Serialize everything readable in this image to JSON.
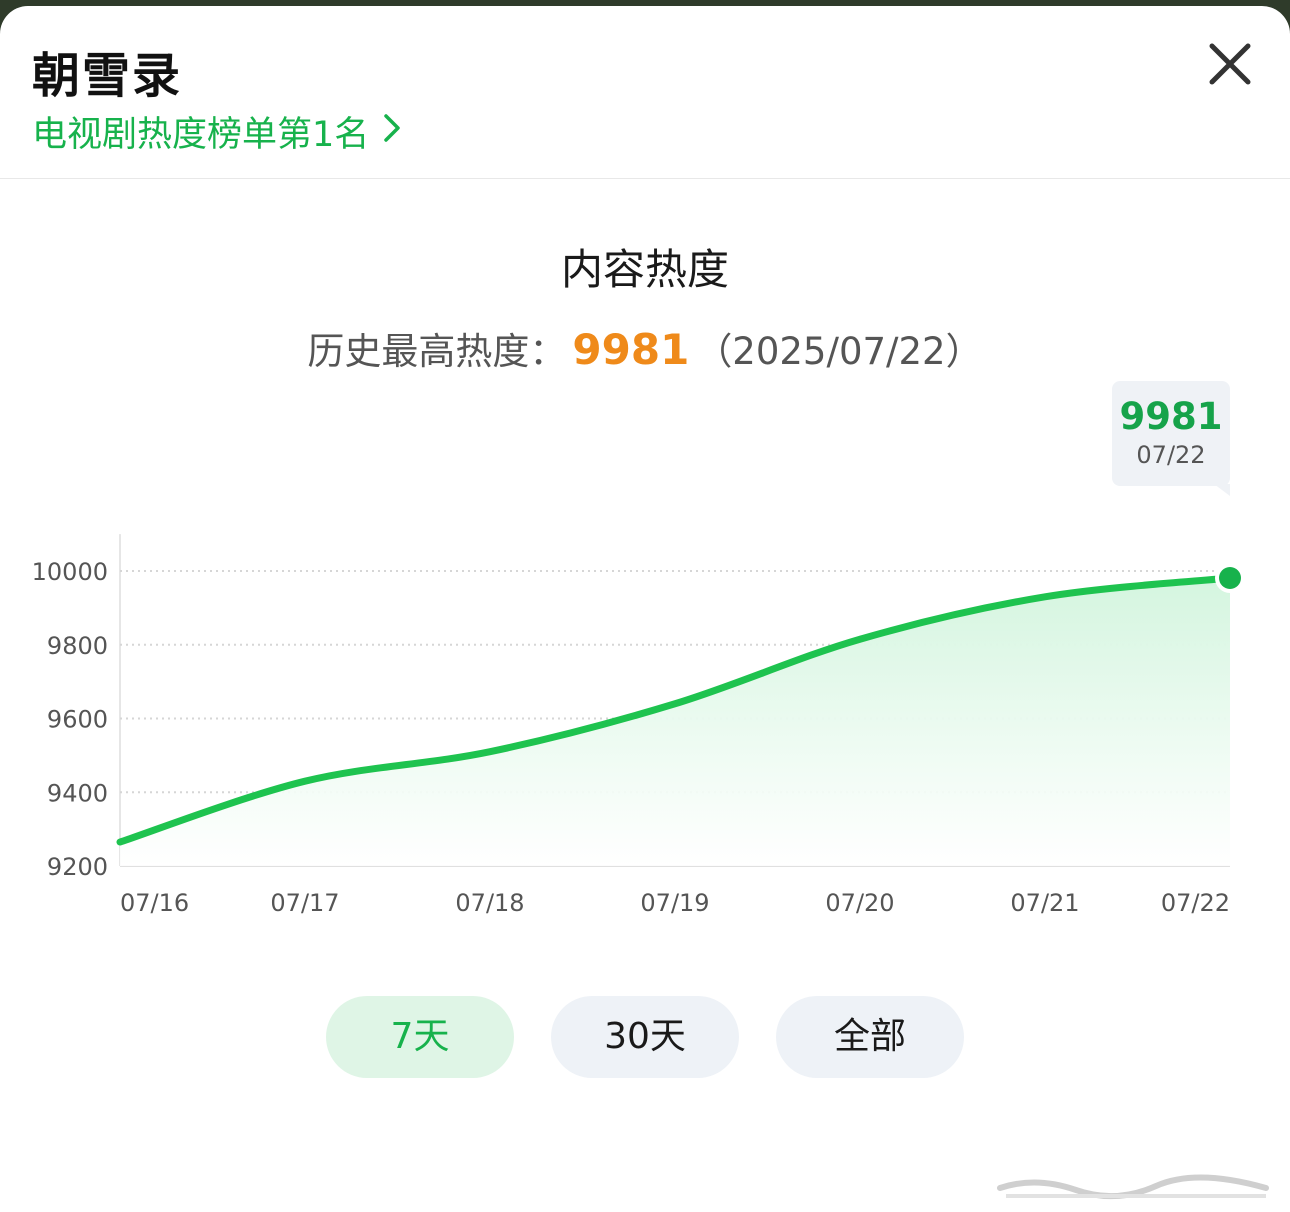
{
  "header": {
    "title": "朝雪录",
    "rank_link": "电视剧热度榜单第1名"
  },
  "chart_title": "内容热度",
  "record": {
    "label": "历史最高热度：",
    "value": "9981",
    "date": "（2025/07/22）"
  },
  "tooltip": {
    "value": "9981",
    "date": "07/22"
  },
  "range_buttons": [
    "7天",
    "30天",
    "全部"
  ],
  "active_range": "7天",
  "colors": {
    "accent": "#17b24c",
    "record": "#ef8a1a",
    "area_top": "#d4f5df"
  },
  "chart_data": {
    "type": "area",
    "x": [
      "07/16",
      "07/17",
      "07/18",
      "07/19",
      "07/20",
      "07/21",
      "07/22"
    ],
    "series": [
      {
        "values": [
          9265,
          9430,
          9510,
          9640,
          9815,
          9930,
          9981
        ]
      }
    ],
    "ylim": [
      9200,
      10100
    ],
    "yticks": [
      9200,
      9400,
      9600,
      9800,
      10000
    ],
    "grid": true,
    "highlight": {
      "x": "07/22",
      "y": 9981
    }
  }
}
